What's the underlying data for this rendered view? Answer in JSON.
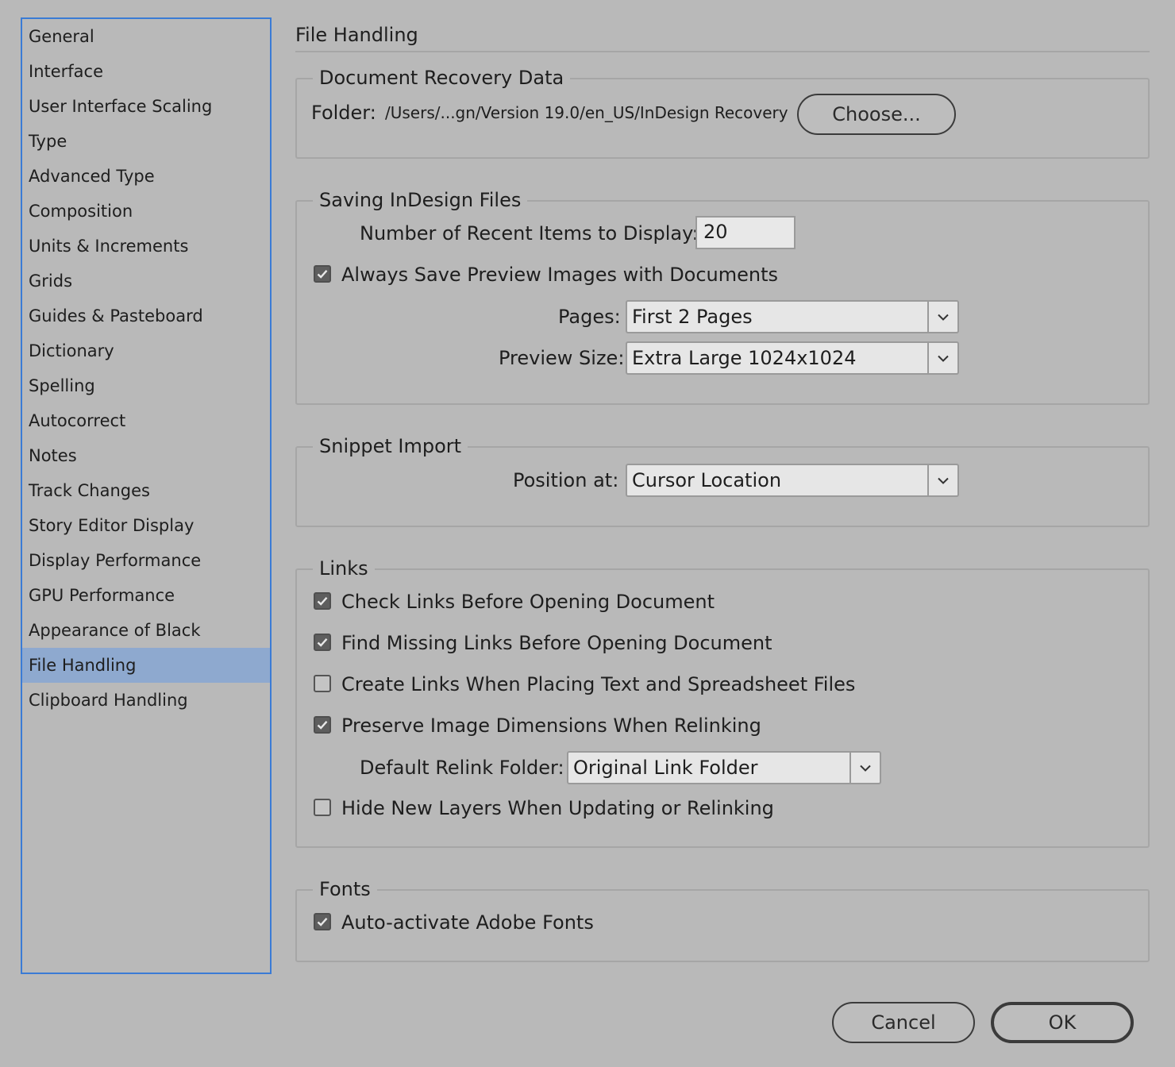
{
  "sidebar": {
    "items": [
      {
        "label": "General"
      },
      {
        "label": "Interface"
      },
      {
        "label": "User Interface Scaling"
      },
      {
        "label": "Type"
      },
      {
        "label": "Advanced Type"
      },
      {
        "label": "Composition"
      },
      {
        "label": "Units & Increments"
      },
      {
        "label": "Grids"
      },
      {
        "label": "Guides & Pasteboard"
      },
      {
        "label": "Dictionary"
      },
      {
        "label": "Spelling"
      },
      {
        "label": "Autocorrect"
      },
      {
        "label": "Notes"
      },
      {
        "label": "Track Changes"
      },
      {
        "label": "Story Editor Display"
      },
      {
        "label": "Display Performance"
      },
      {
        "label": "GPU Performance"
      },
      {
        "label": "Appearance of Black"
      },
      {
        "label": "File Handling",
        "selected": true
      },
      {
        "label": "Clipboard Handling"
      }
    ]
  },
  "main": {
    "title": "File Handling",
    "recovery": {
      "legend": "Document Recovery Data",
      "folder_label": "Folder:",
      "folder_path": "/Users/...gn/Version 19.0/en_US/InDesign Recovery",
      "choose_label": "Choose..."
    },
    "saving": {
      "legend": "Saving InDesign Files",
      "recent_label": "Number of Recent Items to Display:",
      "recent_value": "20",
      "preview_checkbox": {
        "label": "Always Save Preview Images with Documents",
        "checked": true
      },
      "pages_label": "Pages:",
      "pages_value": "First 2 Pages",
      "preview_size_label": "Preview Size:",
      "preview_size_value": "Extra Large 1024x1024"
    },
    "snippet": {
      "legend": "Snippet Import",
      "position_label": "Position at:",
      "position_value": "Cursor Location"
    },
    "links": {
      "legend": "Links",
      "check_links": {
        "label": "Check Links Before Opening Document",
        "checked": true
      },
      "find_missing": {
        "label": "Find Missing Links Before Opening Document",
        "checked": true
      },
      "create_links": {
        "label": "Create Links When Placing Text and Spreadsheet Files",
        "checked": false
      },
      "preserve_dims": {
        "label": "Preserve Image Dimensions When Relinking",
        "checked": true
      },
      "relink_folder_label": "Default Relink Folder:",
      "relink_folder_value": "Original Link Folder",
      "hide_layers": {
        "label": "Hide New Layers When Updating or Relinking",
        "checked": false
      }
    },
    "fonts": {
      "legend": "Fonts",
      "auto_activate": {
        "label": "Auto-activate Adobe Fonts",
        "checked": true
      }
    }
  },
  "footer": {
    "cancel_label": "Cancel",
    "ok_label": "OK"
  },
  "colors": {
    "background": "#b9b9b9",
    "selection": "#8ea9cf",
    "focus_border": "#3a7bd5"
  }
}
